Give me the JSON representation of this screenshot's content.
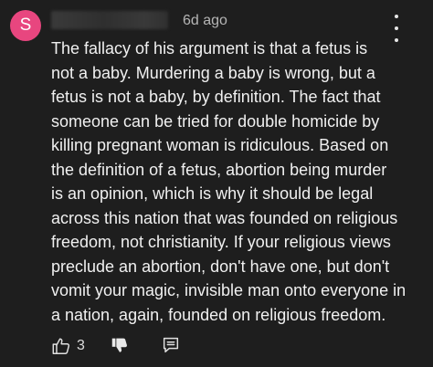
{
  "comment": {
    "avatar_letter": "S",
    "avatar_color": "#e8467f",
    "timestamp": "6d ago",
    "text_lines": [
      "The fallacy of his argument is that a fetus is",
      "not a baby.  Murdering a baby is wrong, but a",
      "fetus is not a baby, by definition. The fact that",
      "someone can be tried for double homicide by",
      "killing pregnant woman is ridiculous.  Based on",
      "the definition of a fetus, abortion being murder",
      "is an opinion, which is why it should be legal",
      "across this nation that was founded on religious",
      "freedom, not christianity.  If your religious views",
      "preclude an abortion, don't have one, but don't",
      "vomit your magic, invisible man onto everyone in",
      "a nation, again, founded on religious freedom."
    ],
    "like_count": "3",
    "icons": {
      "more": "more-vertical-icon",
      "like": "thumbs-up-icon",
      "dislike": "thumbs-down-icon",
      "reply": "reply-icon"
    }
  }
}
